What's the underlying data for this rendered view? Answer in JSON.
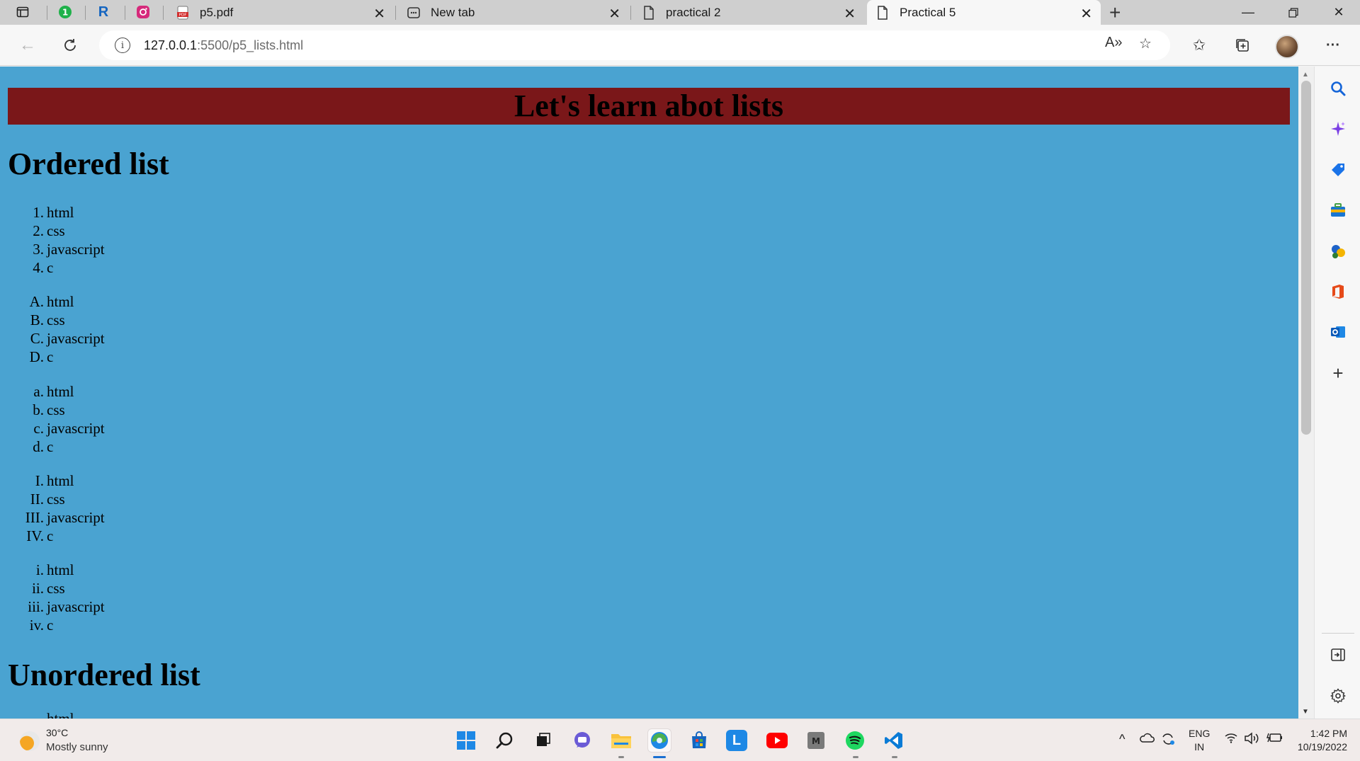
{
  "browser": {
    "tabs": [
      {
        "title": "p5.pdf",
        "active": false
      },
      {
        "title": "New tab",
        "active": false
      },
      {
        "title": "practical 2",
        "active": false
      },
      {
        "title": "Practical 5",
        "active": true
      }
    ],
    "address": {
      "host": "127.0.0.1",
      "path": ":5500/p5_lists.html"
    },
    "read_aloud_label": "A»"
  },
  "page": {
    "banner": "Let's learn abot lists",
    "ordered_heading": "Ordered list",
    "unordered_heading": "Unordered list",
    "ordered_lists": [
      {
        "style": "decimal",
        "items": [
          {
            "marker": "1.",
            "text": "html"
          },
          {
            "marker": "2.",
            "text": "css"
          },
          {
            "marker": "3.",
            "text": "javascript"
          },
          {
            "marker": "4.",
            "text": "c"
          }
        ]
      },
      {
        "style": "upper-alpha",
        "items": [
          {
            "marker": "A.",
            "text": "html"
          },
          {
            "marker": "B.",
            "text": "css"
          },
          {
            "marker": "C.",
            "text": "javascript"
          },
          {
            "marker": "D.",
            "text": "c"
          }
        ]
      },
      {
        "style": "lower-alpha",
        "items": [
          {
            "marker": "a.",
            "text": "html"
          },
          {
            "marker": "b.",
            "text": "css"
          },
          {
            "marker": "c.",
            "text": "javascript"
          },
          {
            "marker": "d.",
            "text": "c"
          }
        ]
      },
      {
        "style": "upper-roman",
        "items": [
          {
            "marker": "I.",
            "text": "html"
          },
          {
            "marker": "II.",
            "text": "css"
          },
          {
            "marker": "III.",
            "text": "javascript"
          },
          {
            "marker": "IV.",
            "text": "c"
          }
        ]
      },
      {
        "style": "lower-roman",
        "items": [
          {
            "marker": "i.",
            "text": "html"
          },
          {
            "marker": "ii.",
            "text": "css"
          },
          {
            "marker": "iii.",
            "text": "javascript"
          },
          {
            "marker": "iv.",
            "text": "c"
          }
        ]
      }
    ],
    "unordered_partial_item": "html",
    "colors": {
      "page_bg": "#4aa3d1",
      "banner_bg": "#7a1719"
    }
  },
  "taskbar": {
    "weather": {
      "temp": "30°C",
      "desc": "Mostly sunny"
    },
    "language": {
      "lang": "ENG",
      "region": "IN"
    },
    "clock": {
      "time": "1:42 PM",
      "date": "10/19/2022"
    },
    "apps": [
      "start-icon",
      "search-icon",
      "task-view-icon",
      "teams-chat-icon",
      "file-explorer-icon",
      "edge-icon",
      "store-icon",
      "l-app-icon",
      "youtube-icon",
      "m-app-icon",
      "spotify-icon",
      "vscode-icon"
    ]
  }
}
